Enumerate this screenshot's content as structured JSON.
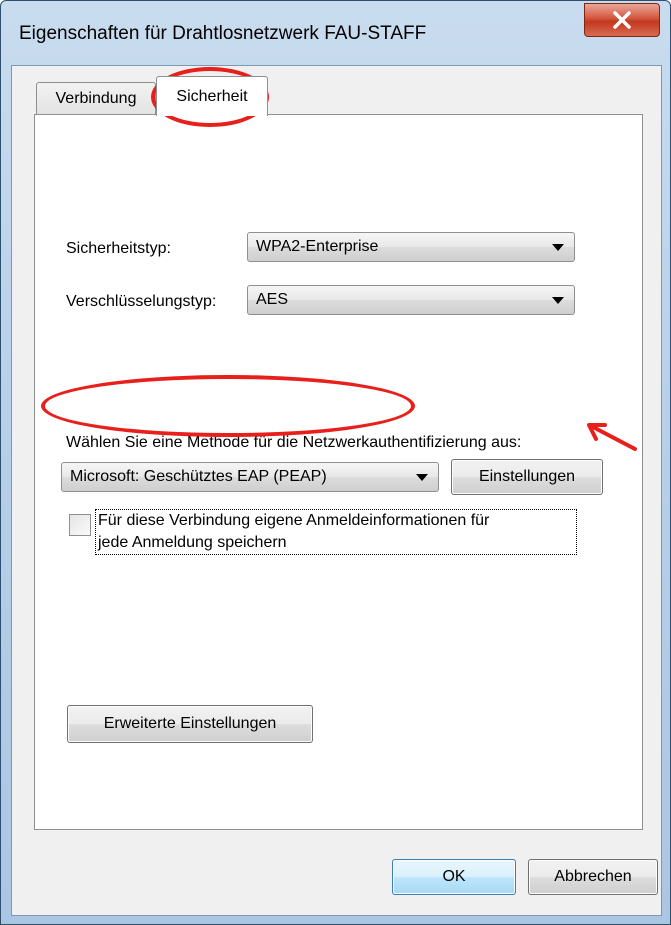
{
  "window": {
    "title": "Eigenschaften für Drahtlosnetzwerk FAU-STAFF",
    "close_icon": "close-icon"
  },
  "tabs": {
    "verbindung": "Verbindung",
    "sicherheit": "Sicherheit"
  },
  "security": {
    "type_label": "Sicherheitstyp:",
    "type_value": "WPA2-Enterprise",
    "encryption_label": "Verschlüsselungstyp:",
    "encryption_value": "AES",
    "auth_method_label": "Wählen Sie eine Methode für die Netzwerkauthentifizierung aus:",
    "auth_method_value": "Microsoft: Geschütztes EAP (PEAP)",
    "settings_button": "Einstellungen",
    "remember_checkbox_line1": "Für diese Verbindung eigene Anmeldeinformationen für",
    "remember_checkbox_line2": "jede Anmeldung speichern",
    "remember_checked": false,
    "advanced_button": "Erweiterte Einstellungen"
  },
  "footer": {
    "ok_button": "OK",
    "cancel_button": "Abbrechen"
  },
  "annotation_color": "#e8201c"
}
